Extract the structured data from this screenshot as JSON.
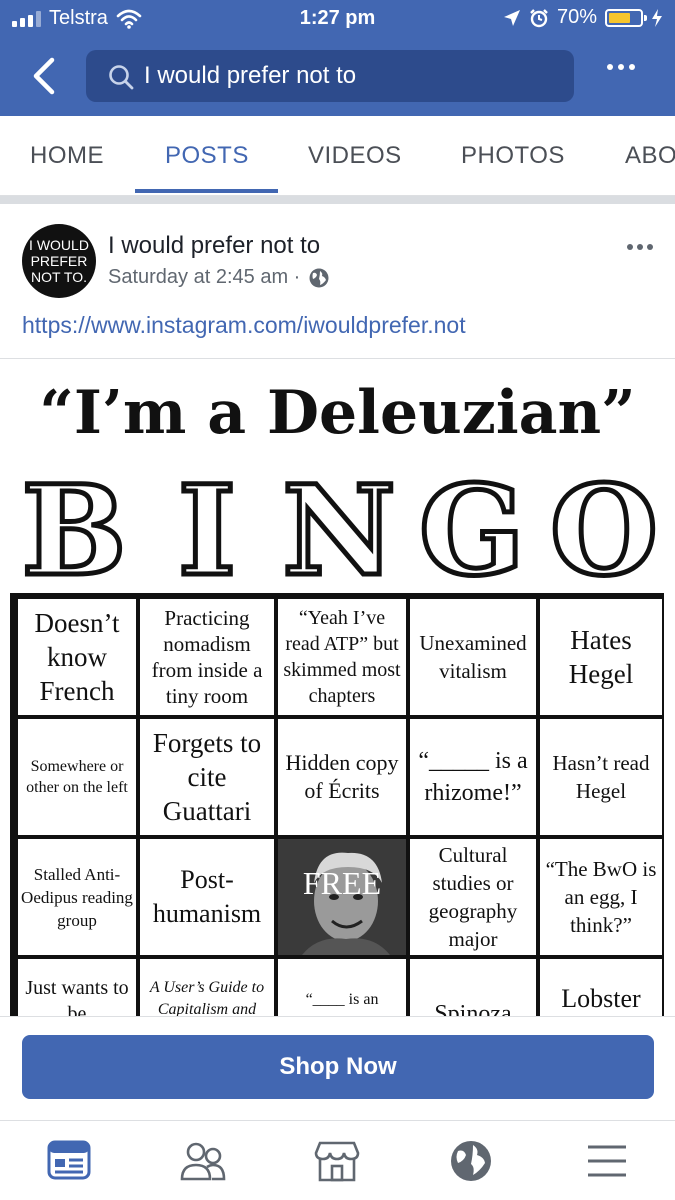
{
  "status_bar": {
    "carrier": "Telstra",
    "time": "1:27 pm",
    "battery_percent": "70%",
    "battery_level": 0.7,
    "accent": "#4267b2"
  },
  "search": {
    "query": "I would prefer not to"
  },
  "tabs": [
    {
      "label": "HOME",
      "active": false
    },
    {
      "label": "POSTS",
      "active": true
    },
    {
      "label": "VIDEOS",
      "active": false
    },
    {
      "label": "PHOTOS",
      "active": false
    },
    {
      "label": "ABO",
      "active": false
    }
  ],
  "post": {
    "avatar_text": [
      "I WOULD",
      "PREFER",
      "NOT TO."
    ],
    "page_name": "I would prefer not to",
    "timestamp": "Saturday at 2:45 am ·",
    "link": "https://www.instagram.com/iwouldprefer.not"
  },
  "bingo": {
    "title": "“I’m a Deleuzian”",
    "letters": [
      "B",
      "I",
      "N",
      "G",
      "O"
    ],
    "cells": [
      "Doesn’t know French",
      "Practicing nomadism from inside a tiny room",
      "“Yeah I’ve read ATP” but skimmed most chapters",
      "Unexamined vitalism",
      "Hates Hegel",
      "Somewhere or other on the left",
      "Forgets to cite Guattari",
      "Hidden copy of Écrits",
      "“_____ is a rhizome!”",
      "Hasn’t read Hegel",
      "Stalled Anti-Oedipus reading group",
      "Post-humanism",
      "FREE SPACE",
      "Cultural studies or geography major",
      "“The BwO is an egg, I think?”",
      "Just wants to be",
      "A User’s Guide to Capitalism and",
      "“____ is an",
      "Spinoza",
      "Lobster"
    ]
  },
  "shop_button": "Shop Now",
  "bottom_nav": [
    {
      "icon": "news-feed-icon",
      "active": true
    },
    {
      "icon": "friends-icon",
      "active": false
    },
    {
      "icon": "marketplace-icon",
      "active": false
    },
    {
      "icon": "notifications-globe-icon",
      "active": false
    },
    {
      "icon": "menu-icon",
      "active": false
    }
  ]
}
